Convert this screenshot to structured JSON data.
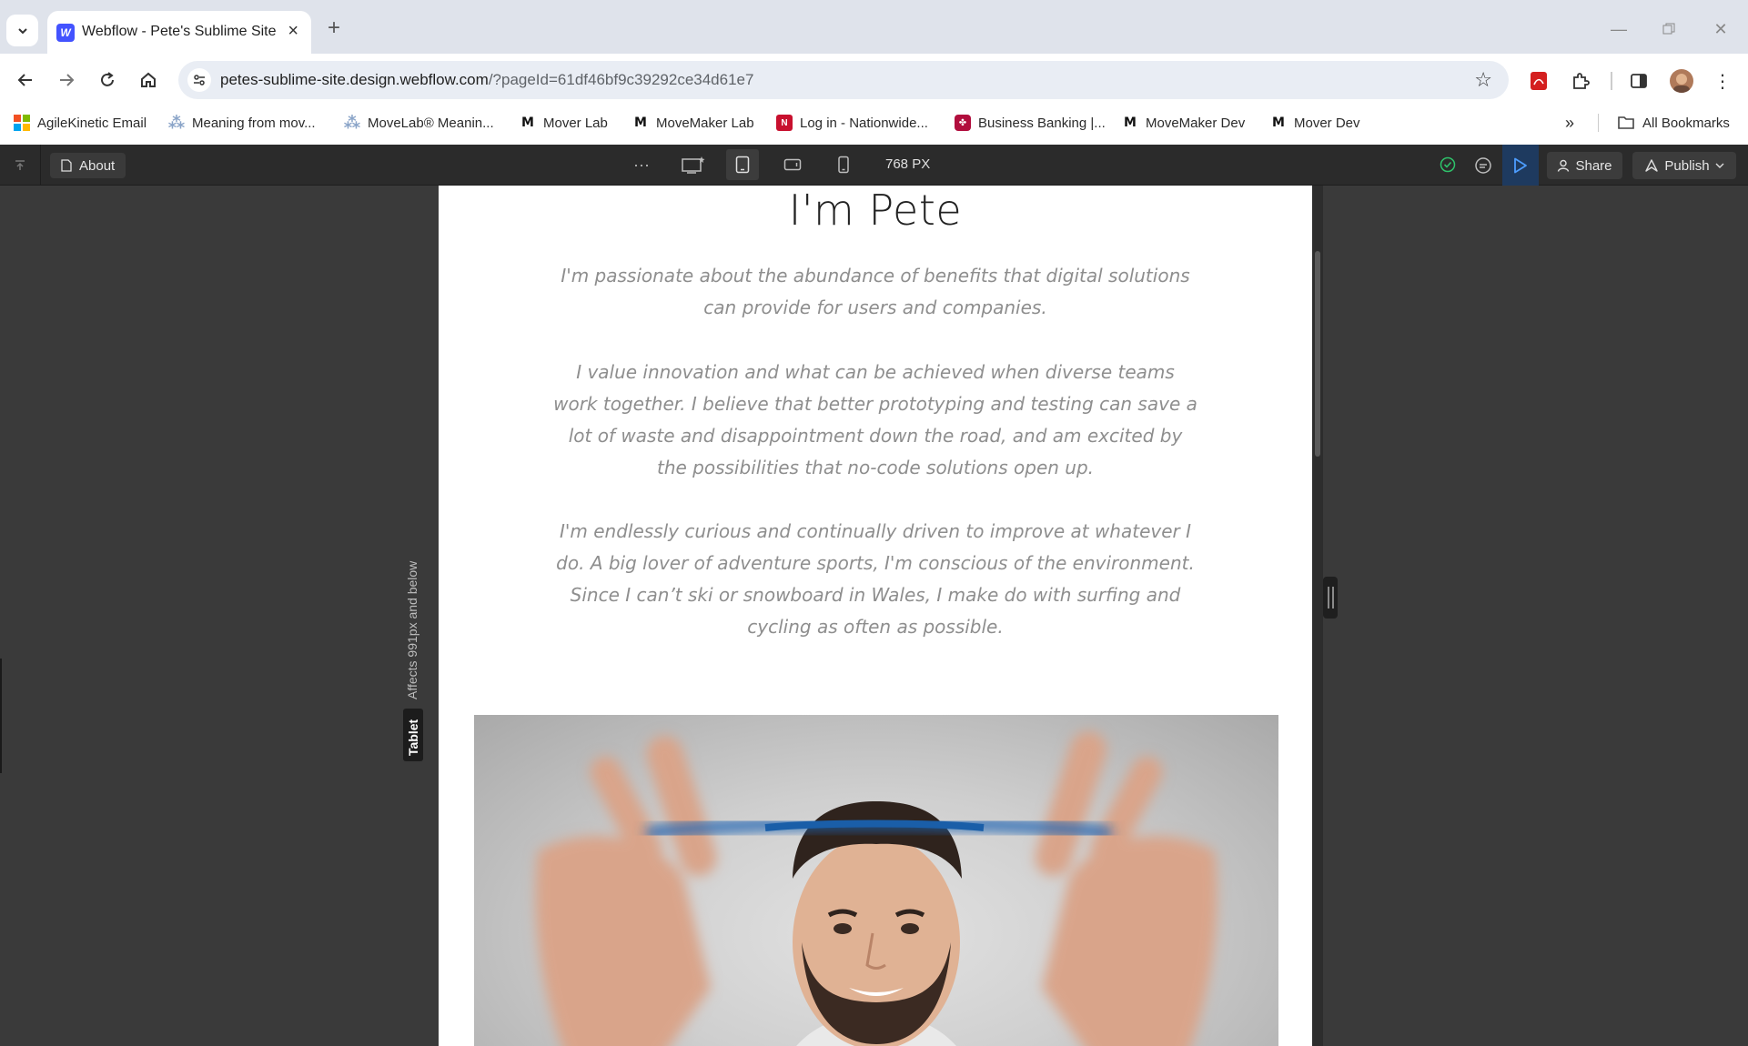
{
  "browser": {
    "tab_title": "Webflow - Pete's Sublime Site",
    "url_host": "petes-sublime-site.design.webflow.com",
    "url_path": "/?pageId=61df46bf9c39292ce34d61e7",
    "bookmarks": [
      {
        "label": "AgileKinetic Email",
        "icon": "microsoft-icon"
      },
      {
        "label": "Meaning from mov...",
        "icon": "movelab-icon"
      },
      {
        "label": "MoveLab® Meanin...",
        "icon": "movelab-icon"
      },
      {
        "label": "Mover Lab",
        "icon": "m-icon"
      },
      {
        "label": "MoveMaker Lab",
        "icon": "m-icon"
      },
      {
        "label": "Log in - Nationwide...",
        "icon": "nationwide-icon"
      },
      {
        "label": "Business Banking |...",
        "icon": "bank-icon"
      },
      {
        "label": "MoveMaker Dev",
        "icon": "m-icon"
      },
      {
        "label": "Mover Dev",
        "icon": "m-icon"
      }
    ],
    "all_bookmarks_label": "All Bookmarks"
  },
  "webflow": {
    "page_name": "About",
    "canvas_width": "768 PX",
    "share_label": "Share",
    "publish_label": "Publish",
    "breakpoint_note": "Affects 991px and below",
    "breakpoint_name": "Tablet"
  },
  "page": {
    "title": "I'm Pete",
    "bio": [
      "I'm passionate about the abundance of benefits that digital solutions can provide for users and companies.",
      "I value innovation and what can be achieved when diverse teams work together. I believe that better prototyping and testing can save a lot of waste and disappointment down the road, and am excited by the possibilities that no-code solutions open up.",
      "I'm endlessly curious and continually driven to improve at whatever I do. A big lover of adventure sports, I'm conscious of the environment. Since I can’t ski or snowboard in Wales, I make do with surfing and cycling as often as possible."
    ]
  },
  "colors": {
    "webflow_blue": "#4353ff",
    "editor_dark": "#2b2b2b",
    "canvas_bg": "#3a3a3a",
    "body_text": "#8e8e8e"
  }
}
